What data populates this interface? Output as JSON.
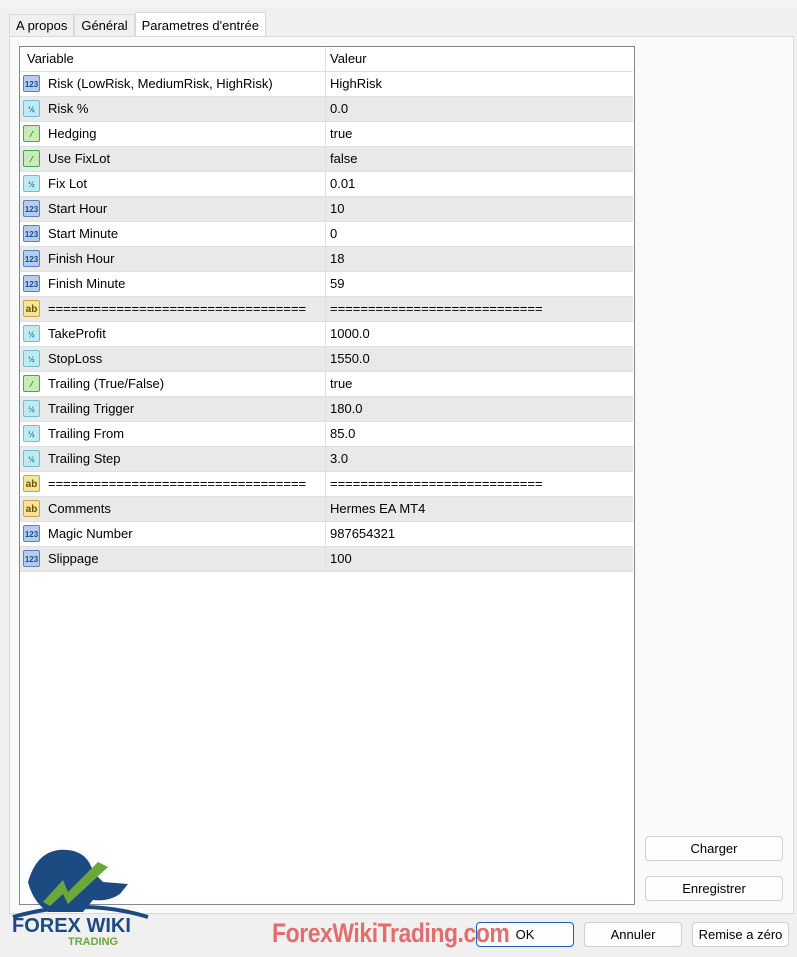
{
  "tabs": [
    "A propos",
    "Général",
    "Parametres d'entrée"
  ],
  "table": {
    "headers": {
      "variable": "Variable",
      "value": "Valeur"
    },
    "rows": [
      {
        "type": "int",
        "name": "Risk (LowRisk, MediumRisk, HighRisk)",
        "value": "HighRisk"
      },
      {
        "type": "double",
        "name": "Risk %",
        "value": "0.0"
      },
      {
        "type": "bool",
        "name": "Hedging",
        "value": "true"
      },
      {
        "type": "bool",
        "name": "Use FixLot",
        "value": "false"
      },
      {
        "type": "double",
        "name": "Fix Lot",
        "value": "0.01"
      },
      {
        "type": "int",
        "name": "Start Hour",
        "value": "10"
      },
      {
        "type": "int",
        "name": "Start Minute",
        "value": "0"
      },
      {
        "type": "int",
        "name": "Finish Hour",
        "value": "18"
      },
      {
        "type": "int",
        "name": "Finish Minute",
        "value": "59"
      },
      {
        "type": "string",
        "name": "==================================",
        "value": "============================"
      },
      {
        "type": "double",
        "name": "TakeProfit",
        "value": "1000.0"
      },
      {
        "type": "double",
        "name": "StopLoss",
        "value": "1550.0"
      },
      {
        "type": "bool",
        "name": "Trailing (True/False)",
        "value": "true"
      },
      {
        "type": "double",
        "name": "Trailing Trigger",
        "value": "180.0"
      },
      {
        "type": "double",
        "name": "Trailing From",
        "value": "85.0"
      },
      {
        "type": "double",
        "name": "Trailing Step",
        "value": "3.0"
      },
      {
        "type": "string",
        "name": "==================================",
        "value": "============================"
      },
      {
        "type": "string",
        "name": "Comments",
        "value": "Hermes EA MT4"
      },
      {
        "type": "int",
        "name": "Magic Number",
        "value": "987654321"
      },
      {
        "type": "int",
        "name": "Slippage",
        "value": "100"
      }
    ]
  },
  "icons": {
    "int": "123",
    "double": "½",
    "bool": "⁄",
    "string": "ab"
  },
  "buttons": {
    "load": "Charger",
    "save": "Enregistrer",
    "ok": "OK",
    "cancel": "Annuler",
    "reset": "Remise a zéro"
  },
  "watermark": "ForexWikiTrading.com",
  "logo": {
    "line1": "FOREX WIKI",
    "line2": "TRADING"
  }
}
